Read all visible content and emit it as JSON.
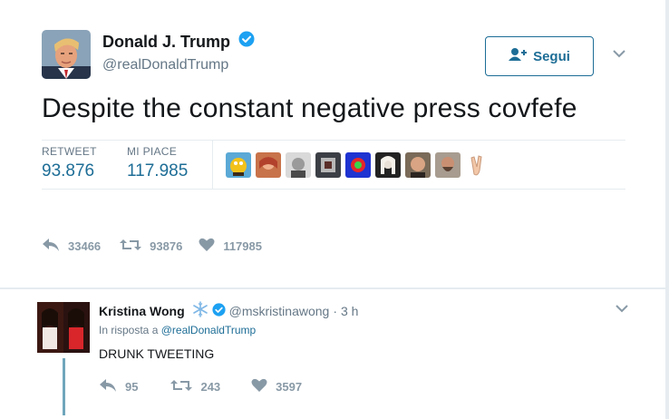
{
  "tweet": {
    "author_name": "Donald J. Trump",
    "author_handle": "@realDonaldTrump",
    "follow_label": "Segui",
    "text": "Despite the constant negative press covfefe",
    "stats": {
      "retweet_label": "RETWEET",
      "retweet_value": "93.876",
      "likes_label": "MI PIACE",
      "likes_value": "117.985"
    },
    "actions": {
      "reply_count": "33466",
      "retweet_count": "93876",
      "like_count": "117985"
    }
  },
  "reply": {
    "author_name": "Kristina Wong",
    "author_handle": "@mskristinawong",
    "separator": "·",
    "time": "3 h",
    "in_reply_prefix": "In risposta a",
    "in_reply_handle": "@realDonaldTrump",
    "text": "DRUNK TWEETING",
    "actions": {
      "reply_count": "95",
      "retweet_count": "243",
      "like_count": "3597"
    }
  },
  "colors": {
    "link": "#1d6d96",
    "verified": "#1da1f2",
    "muted": "#657786",
    "icon": "#8899a6",
    "background": "#e6ecf0"
  },
  "icons": [
    "verified-badge-icon",
    "follow-person-plus-icon",
    "chevron-down-icon",
    "reply-icon",
    "retweet-icon",
    "heart-icon",
    "snowflake-icon"
  ]
}
